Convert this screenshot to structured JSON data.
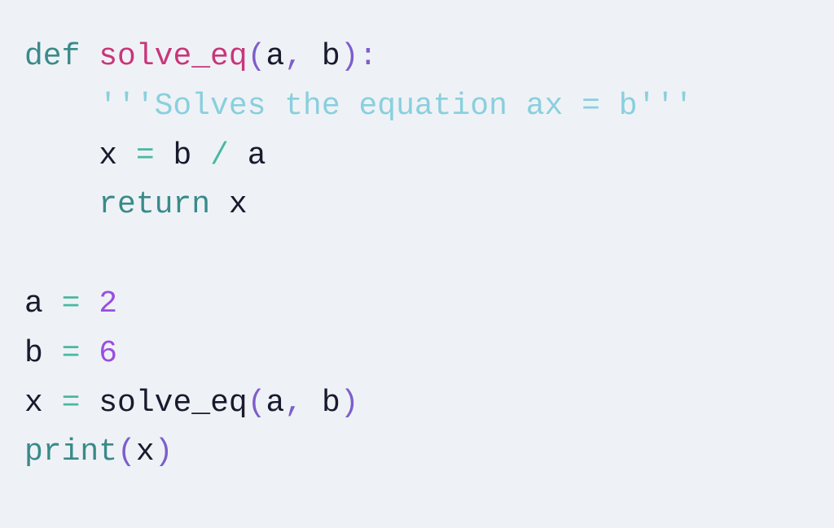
{
  "code": {
    "line1": {
      "def": "def",
      "fname": "solve_eq",
      "lparen": "(",
      "p1": "a",
      "comma": ",",
      "sp": " ",
      "p2": "b",
      "rparen": ")",
      "colon": ":"
    },
    "line2": {
      "indent": "    ",
      "doc": "'''Solves the equation ax = b'''"
    },
    "line3": {
      "indent": "    ",
      "x": "x",
      "sp1": " ",
      "eq": "=",
      "sp2": " ",
      "b": "b",
      "sp3": " ",
      "slash": "/",
      "sp4": " ",
      "a": "a"
    },
    "line4": {
      "indent": "    ",
      "ret": "return",
      "sp": " ",
      "x": "x"
    },
    "line6": {
      "a": "a",
      "sp1": " ",
      "eq": "=",
      "sp2": " ",
      "val": "2"
    },
    "line7": {
      "b": "b",
      "sp1": " ",
      "eq": "=",
      "sp2": " ",
      "val": "6"
    },
    "line8": {
      "x": "x",
      "sp1": " ",
      "eq": "=",
      "sp2": " ",
      "call": "solve_eq",
      "lparen": "(",
      "a": "a",
      "comma": ",",
      "sp3": " ",
      "b": "b",
      "rparen": ")"
    },
    "line9": {
      "print": "print",
      "lparen": "(",
      "x": "x",
      "rparen": ")"
    }
  }
}
